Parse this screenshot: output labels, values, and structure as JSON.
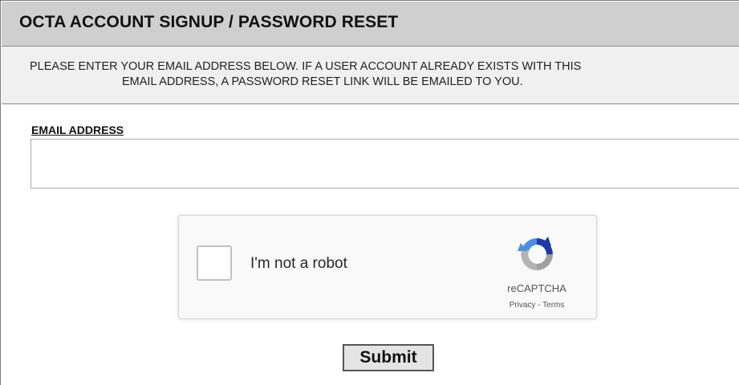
{
  "header": {
    "title": "OCTA ACCOUNT SIGNUP / PASSWORD RESET"
  },
  "instructions": {
    "line1": "PLEASE ENTER YOUR EMAIL ADDRESS BELOW. IF A USER ACCOUNT ALREADY EXISTS WITH THIS",
    "line2": "EMAIL ADDRESS, A PASSWORD RESET LINK WILL BE EMAILED TO YOU."
  },
  "form": {
    "email_label": "EMAIL ADDRESS",
    "email_value": "",
    "email_placeholder": ""
  },
  "captcha": {
    "label": "I'm not a robot",
    "checked": false,
    "brand": "reCAPTCHA",
    "privacy": "Privacy",
    "separator": " - ",
    "terms": "Terms",
    "logo_icon": "recaptcha-logo-icon"
  },
  "actions": {
    "submit_label": "Submit"
  },
  "colors": {
    "header_bg": "#cfcfcf",
    "instructions_bg": "#f0f0f0",
    "captcha_bg": "#f9f9f9",
    "recaptcha_blue": "#1c3aa9",
    "recaptcha_light_blue": "#4a90e2",
    "recaptcha_gray": "#b4b4b4"
  }
}
